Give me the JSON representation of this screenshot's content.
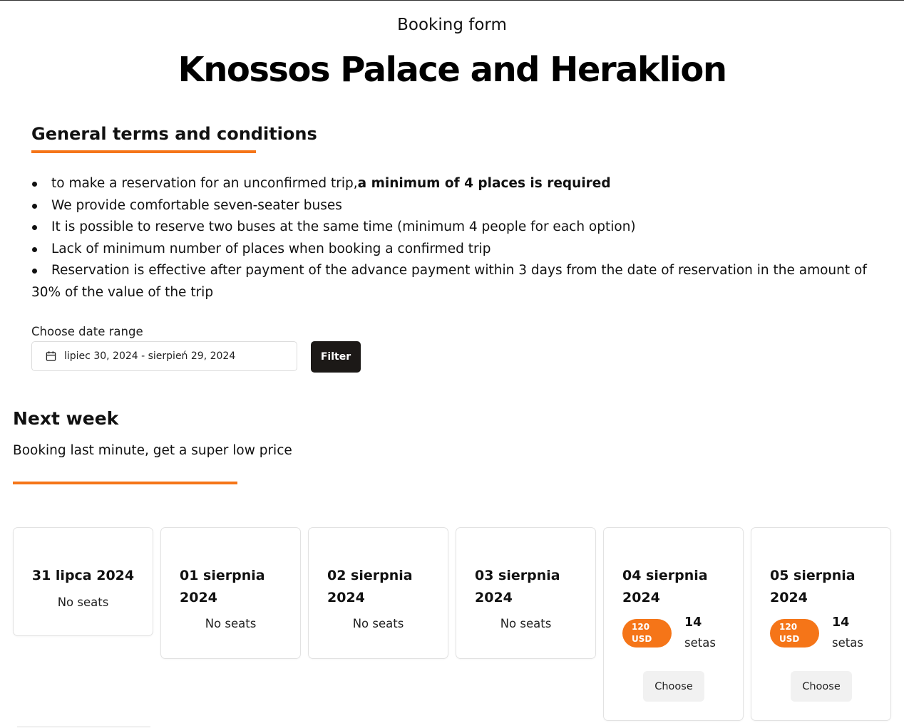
{
  "header": {
    "subtitle": "Booking form",
    "title": "Knossos Palace and Heraklion"
  },
  "terms": {
    "heading": "General terms and conditions",
    "items": [
      {
        "text": "to make a reservation for an unconfirmed trip,",
        "bold": "a minimum of 4 places is required"
      },
      {
        "text": "We provide comfortable seven-seater buses"
      },
      {
        "text": "It is possible to reserve two buses at the same time (minimum 4 people for each option)"
      },
      {
        "text": "Lack of minimum number of places when booking a confirmed trip"
      },
      {
        "text": "Reservation is effective after payment of the advance payment within 3 days from the date of reservation in the amount of 30% of the value of the trip"
      }
    ]
  },
  "filter": {
    "label": "Choose date range",
    "value": "lipiec 30, 2024 - sierpień 29, 2024",
    "button": "Filter"
  },
  "next_week": {
    "heading": "Next week",
    "subheading": "Booking last minute, get a super low price"
  },
  "cards": [
    {
      "date": "31 lipca 2024",
      "status": "No seats"
    },
    {
      "date": "01 sierpnia 2024",
      "status": "No seats"
    },
    {
      "date": "02 sierpnia 2024",
      "status": "No seats"
    },
    {
      "date": "03 sierpnia 2024",
      "status": "No seats"
    },
    {
      "date": "04 sierpnia 2024",
      "price": "120 USD",
      "seats": "14",
      "seats_label": "setas",
      "button": "Choose"
    },
    {
      "date": "05 sierpnia 2024",
      "price": "120 USD",
      "seats": "14",
      "seats_label": "setas",
      "button": "Choose"
    }
  ],
  "colors": {
    "accent": "#f57518",
    "button_dark": "#1c1917"
  },
  "icons": {
    "date_input": "calendar-icon"
  }
}
